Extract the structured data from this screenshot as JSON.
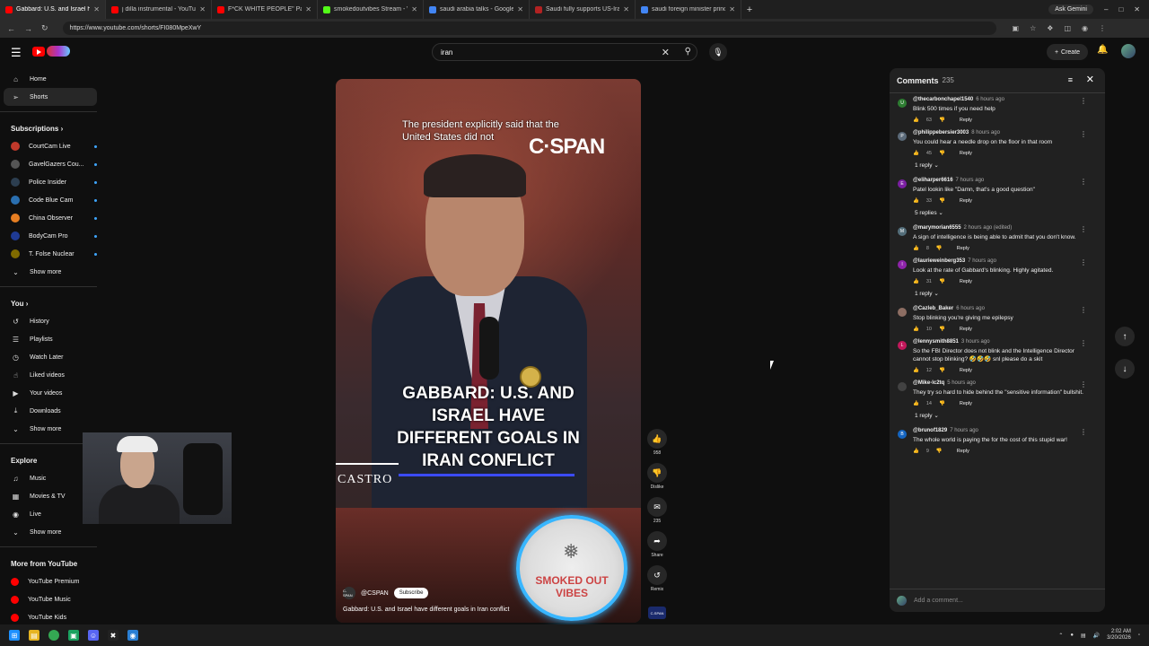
{
  "browser": {
    "tabs": [
      {
        "title": "Gabbard: U.S. and Israel ha",
        "color": "#ff0000",
        "active": true
      },
      {
        "title": "j dilla instrumental - YouTube",
        "color": "#ff0000"
      },
      {
        "title": "F*CK WHITE PEOPLE\" Palestinia",
        "color": "#ff0000"
      },
      {
        "title": "smokedoutvibes Stream - Watc",
        "color": "#53fc18"
      },
      {
        "title": "saudi arabia talks - Google Sea",
        "color": "#4285f4"
      },
      {
        "title": "Saudi fully supports US-Iran ne",
        "color": "#b22222"
      },
      {
        "title": "saudi foreign minister prince fa",
        "color": "#4285f4"
      }
    ],
    "new_tab": "+",
    "ask_gemini": "Ask Gemini",
    "url": "https://www.youtube.com/shorts/FI080MpeXwY"
  },
  "masthead": {
    "search_value": "iran",
    "create_label": "Create"
  },
  "sidebar": {
    "home": "Home",
    "shorts": "Shorts",
    "subscriptions_header": "Subscriptions",
    "subscriptions": [
      {
        "name": "CourtCam Live",
        "color": "#c0392b"
      },
      {
        "name": "GavelGazers Cou...",
        "color": "#555"
      },
      {
        "name": "Police Insider",
        "color": "#2c3e50"
      },
      {
        "name": "Code Blue Cam",
        "color": "#2a6fb0"
      },
      {
        "name": "China Observer",
        "color": "#e67e22"
      },
      {
        "name": "BodyCam Pro",
        "color": "#1f3a93"
      },
      {
        "name": "T. Folse Nuclear",
        "color": "#7f6a00"
      }
    ],
    "show_more": "Show more",
    "you_header": "You",
    "you_items": [
      {
        "label": "History",
        "icon": "history-icon"
      },
      {
        "label": "Playlists",
        "icon": "playlists-icon"
      },
      {
        "label": "Watch Later",
        "icon": "watch-later-icon"
      },
      {
        "label": "Liked videos",
        "icon": "liked-icon"
      },
      {
        "label": "Your videos",
        "icon": "your-videos-icon"
      },
      {
        "label": "Downloads",
        "icon": "downloads-icon"
      }
    ],
    "show_more_2": "Show more",
    "explore_header": "Explore",
    "explore_items": [
      {
        "label": "Music",
        "icon": "music-icon"
      },
      {
        "label": "Movies & TV",
        "icon": "movies-icon"
      },
      {
        "label": "Live",
        "icon": "live-icon"
      }
    ],
    "show_more_3": "Show more",
    "more_header": "More from YouTube",
    "more_items": [
      {
        "label": "YouTube Premium"
      },
      {
        "label": "YouTube Music"
      },
      {
        "label": "YouTube Kids"
      }
    ]
  },
  "video": {
    "caption": "The president explicitly said that the United States did not",
    "network": "C·SPAN",
    "headline": "GABBARD: U.S. AND ISRAEL HAVE DIFFERENT GOALS IN IRAN CONFLICT",
    "name_tag": "CASTRO",
    "channel": "@CSPAN",
    "channel_avatar": "C-SPAN",
    "subscribe": "Subscribe",
    "title": "Gabbard: U.S. and Israel have different goals in Iran conflict",
    "overlay_text": "SMOKED OUT VIBES"
  },
  "actions": {
    "likes": "958",
    "dislike": "Dislike",
    "comments": "235",
    "share": "Share",
    "remix": "Remix",
    "badge": "C-SPAN"
  },
  "comments": {
    "title": "Comments",
    "count": "235",
    "add_placeholder": "Add a comment...",
    "items": [
      {
        "author": "@thecarbonchapel1540",
        "ago": "6 hours ago",
        "text": "Blink 500 times if you need help",
        "likes": "63",
        "avatar": "U",
        "color": "#2e7d32"
      },
      {
        "author": "@philippebersier3003",
        "ago": "8 hours ago",
        "text": "You could hear a needle drop on the floor in that room",
        "likes": "45",
        "avatar": "P",
        "color": "#5c6b7a",
        "replies": "1 reply"
      },
      {
        "author": "@eliharper6616",
        "ago": "7 hours ago",
        "text": "Patel lookin like \"Damn, that's a good question\"",
        "likes": "33",
        "avatar": "E",
        "color": "#7b1fa2",
        "replies": "5 replies"
      },
      {
        "author": "@marymorian6555",
        "ago": "2 hours ago (edited)",
        "text": "A sign of intelligence is being able to admit that you don't know.",
        "likes": "8",
        "avatar": "M",
        "color": "#546e7a"
      },
      {
        "author": "@laurieweinberg353",
        "ago": "7 hours ago",
        "text": "Look at the rate of Gabbard's blinking.  Highly agitated.",
        "likes": "31",
        "avatar": "l",
        "color": "#8e24aa",
        "replies": "1 reply"
      },
      {
        "author": "@Cazleb_Baker",
        "ago": "6 hours ago",
        "text": "Stop blinking you're giving me epilepsy",
        "likes": "10",
        "avatar": "",
        "color": "#8d6e63"
      },
      {
        "author": "@lennysmith8851",
        "ago": "3 hours ago",
        "text": "So the FBI Director does not blink and the Intelligence Director cannot stop blinking? 🤣🤣🤣 snl please do a skit",
        "likes": "12",
        "avatar": "L",
        "color": "#c2185b"
      },
      {
        "author": "@Mike-lc2tq",
        "ago": "5 hours ago",
        "text": "They try so hard to hide behind the \"sensitive information\" bullshit.",
        "likes": "14",
        "avatar": "",
        "color": "#424242",
        "replies": "1 reply"
      },
      {
        "author": "@brunof1829",
        "ago": "7 hours ago",
        "text": "The whole world is paying the for the cost of this stupid war!",
        "likes": "9",
        "avatar": "B",
        "color": "#1565c0"
      }
    ],
    "reply_label": "Reply"
  },
  "taskbar": {
    "time": "2:02 AM",
    "date": "3/20/2026"
  }
}
